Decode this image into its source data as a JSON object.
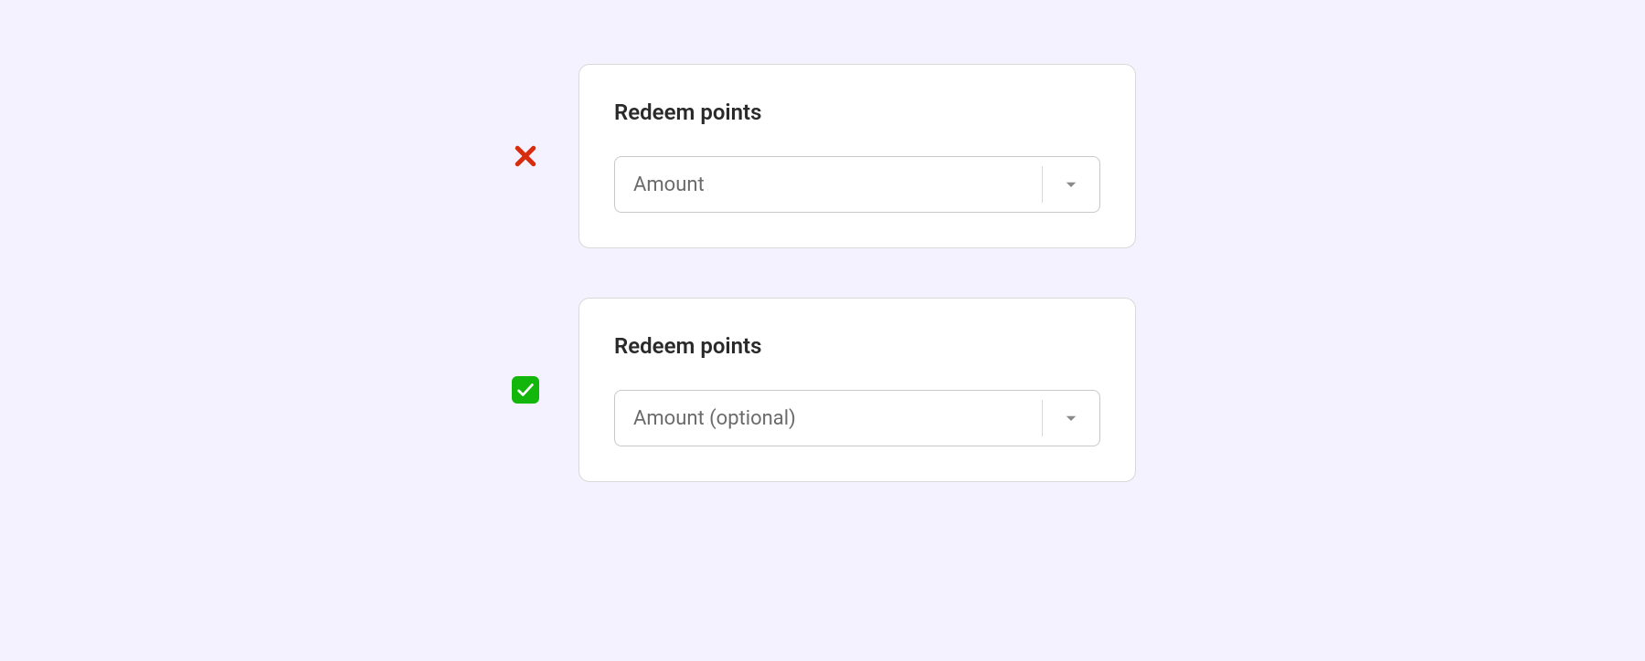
{
  "examples": [
    {
      "status": "bad",
      "title": "Redeem points",
      "placeholder": "Amount"
    },
    {
      "status": "good",
      "title": "Redeem points",
      "placeholder": "Amount (optional)"
    }
  ]
}
